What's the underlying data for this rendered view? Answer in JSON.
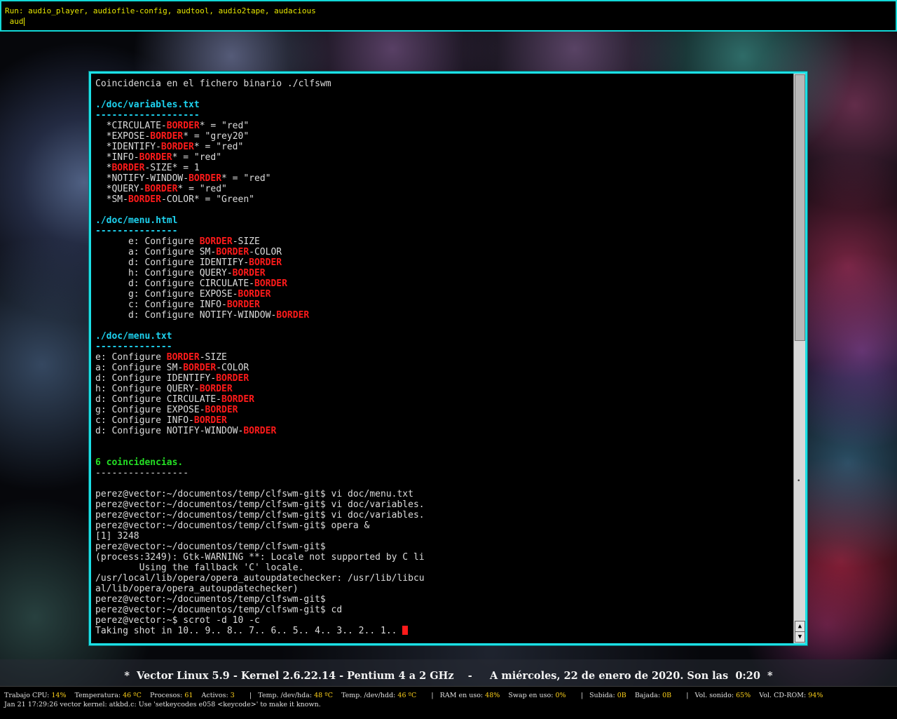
{
  "run_bar": {
    "completions": "Run: audio_player, audiofile-config, audtool, audio2tape, audacious",
    "input_value": " aud"
  },
  "terminal": {
    "lines": [
      {
        "type": "plain",
        "text": "Coincidencia en el fichero binario ./clfswm"
      },
      {
        "type": "blank"
      },
      {
        "type": "header",
        "text": "./doc/variables.txt"
      },
      {
        "type": "underline",
        "text": "-------------------"
      },
      {
        "type": "match",
        "pre": "  *CIRCULATE-",
        "hl": "BORDER",
        "post": "* = \"red\""
      },
      {
        "type": "match",
        "pre": "  *EXPOSE-",
        "hl": "BORDER",
        "post": "* = \"grey20\""
      },
      {
        "type": "match",
        "pre": "  *IDENTIFY-",
        "hl": "BORDER",
        "post": "* = \"red\""
      },
      {
        "type": "match",
        "pre": "  *INFO-",
        "hl": "BORDER",
        "post": "* = \"red\""
      },
      {
        "type": "match",
        "pre": "  *",
        "hl": "BORDER",
        "post": "-SIZE* = 1"
      },
      {
        "type": "match",
        "pre": "  *NOTIFY-WINDOW-",
        "hl": "BORDER",
        "post": "* = \"red\""
      },
      {
        "type": "match",
        "pre": "  *QUERY-",
        "hl": "BORDER",
        "post": "* = \"red\""
      },
      {
        "type": "match",
        "pre": "  *SM-",
        "hl": "BORDER",
        "post": "-COLOR* = \"Green\""
      },
      {
        "type": "blank"
      },
      {
        "type": "header",
        "text": "./doc/menu.html"
      },
      {
        "type": "underline",
        "text": "---------------"
      },
      {
        "type": "match",
        "pre": "      e: Configure ",
        "hl": "BORDER",
        "post": "-SIZE"
      },
      {
        "type": "match",
        "pre": "      a: Configure SM-",
        "hl": "BORDER",
        "post": "-COLOR"
      },
      {
        "type": "match",
        "pre": "      d: Configure IDENTIFY-",
        "hl": "BORDER",
        "post": ""
      },
      {
        "type": "match",
        "pre": "      h: Configure QUERY-",
        "hl": "BORDER",
        "post": ""
      },
      {
        "type": "match",
        "pre": "      d: Configure CIRCULATE-",
        "hl": "BORDER",
        "post": ""
      },
      {
        "type": "match",
        "pre": "      g: Configure EXPOSE-",
        "hl": "BORDER",
        "post": ""
      },
      {
        "type": "match",
        "pre": "      c: Configure INFO-",
        "hl": "BORDER",
        "post": ""
      },
      {
        "type": "match",
        "pre": "      d: Configure NOTIFY-WINDOW-",
        "hl": "BORDER",
        "post": ""
      },
      {
        "type": "blank"
      },
      {
        "type": "header",
        "text": "./doc/menu.txt"
      },
      {
        "type": "underline",
        "text": "--------------"
      },
      {
        "type": "match",
        "pre": "e: Configure ",
        "hl": "BORDER",
        "post": "-SIZE"
      },
      {
        "type": "match",
        "pre": "a: Configure SM-",
        "hl": "BORDER",
        "post": "-COLOR"
      },
      {
        "type": "match",
        "pre": "d: Configure IDENTIFY-",
        "hl": "BORDER",
        "post": ""
      },
      {
        "type": "match",
        "pre": "h: Configure QUERY-",
        "hl": "BORDER",
        "post": ""
      },
      {
        "type": "match",
        "pre": "d: Configure CIRCULATE-",
        "hl": "BORDER",
        "post": ""
      },
      {
        "type": "match",
        "pre": "g: Configure EXPOSE-",
        "hl": "BORDER",
        "post": ""
      },
      {
        "type": "match",
        "pre": "c: Configure INFO-",
        "hl": "BORDER",
        "post": ""
      },
      {
        "type": "match",
        "pre": "d: Configure NOTIFY-WINDOW-",
        "hl": "BORDER",
        "post": ""
      },
      {
        "type": "blank"
      },
      {
        "type": "blank"
      },
      {
        "type": "summary",
        "text": "6 coincidencias."
      },
      {
        "type": "plain",
        "text": "-----------------"
      },
      {
        "type": "blank"
      },
      {
        "type": "plain",
        "text": "perez@vector:~/documentos/temp/clfswm-git$ vi doc/menu.txt"
      },
      {
        "type": "plain",
        "text": "perez@vector:~/documentos/temp/clfswm-git$ vi doc/variables."
      },
      {
        "type": "plain",
        "text": "perez@vector:~/documentos/temp/clfswm-git$ vi doc/variables."
      },
      {
        "type": "plain",
        "text": "perez@vector:~/documentos/temp/clfswm-git$ opera &"
      },
      {
        "type": "plain",
        "text": "[1] 3248"
      },
      {
        "type": "plain",
        "text": "perez@vector:~/documentos/temp/clfswm-git$"
      },
      {
        "type": "plain",
        "text": "(process:3249): Gtk-WARNING **: Locale not supported by C li"
      },
      {
        "type": "plain",
        "text": "        Using the fallback 'C' locale."
      },
      {
        "type": "plain",
        "text": "/usr/local/lib/opera/opera_autoupdatechecker: /usr/lib/libcu"
      },
      {
        "type": "plain",
        "text": "al/lib/opera/opera_autoupdatechecker)"
      },
      {
        "type": "plain",
        "text": "perez@vector:~/documentos/temp/clfswm-git$"
      },
      {
        "type": "plain",
        "text": "perez@vector:~/documentos/temp/clfswm-git$ cd"
      },
      {
        "type": "plain",
        "text": "perez@vector:~$ scrot -d 10 -c"
      },
      {
        "type": "cursor",
        "text": "Taking shot in 10.. 9.. 8.. 7.. 6.. 5.. 4.. 3.. 2.. 1.. "
      }
    ],
    "scrollbar": {
      "up_arrow": "▲",
      "down_arrow": "▼",
      "position": 0.47
    }
  },
  "title_bar": {
    "text": "*  Vector Linux 5.9 - Kernel 2.6.22.14 - Pentium 4 a 2 GHz    -     A miércoles, 22 de enero de 2020. Son las  0:20  *"
  },
  "status_line": {
    "items": [
      {
        "label": "Trabajo CPU: ",
        "value": "14%"
      },
      {
        "label": "Temperatura: ",
        "value": "46 ºC"
      },
      {
        "label": "Procesos: ",
        "value": "61"
      },
      {
        "label": "Activos: ",
        "value": "3"
      },
      {
        "sep": "|"
      },
      {
        "label": "Temp. /dev/hda: ",
        "value": "48 ºC"
      },
      {
        "label": "Temp. /dev/hdd: ",
        "value": "46 ºC"
      },
      {
        "sep": "|"
      },
      {
        "label": "RAM en uso: ",
        "value": "48%"
      },
      {
        "label": "Swap en uso: ",
        "value": "0%"
      },
      {
        "sep": "|"
      },
      {
        "label": "Subida: ",
        "value": "0B"
      },
      {
        "label": "Bajada: ",
        "value": "0B"
      },
      {
        "sep": "|"
      },
      {
        "label": "Vol. sonido: ",
        "value": "65%"
      },
      {
        "label": "Vol. CD-ROM: ",
        "value": "94%"
      }
    ],
    "kernel_message": "Jan 21 17:29:26 vector kernel: atkbd.c: Use 'setkeycodes e058 <keycode>' to make it known."
  },
  "colors": {
    "border_cyan": "#1ce0e6",
    "highlight_red": "#ff1a1a",
    "header_cyan": "#1ed3f0",
    "summary_green": "#24e024",
    "status_value_yellow": "#ffd21a",
    "run_bar_text": "#e6e600"
  }
}
